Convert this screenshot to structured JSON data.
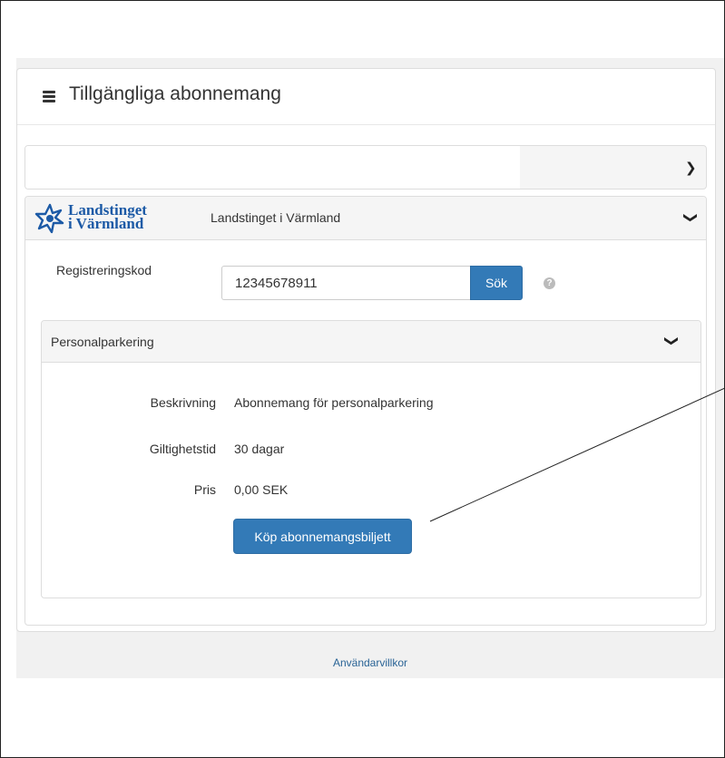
{
  "header": {
    "title": "Tillgängliga abonnemang",
    "icon": "list-icon"
  },
  "collapsed_panel": {
    "icon": "chevron-right-icon"
  },
  "organization": {
    "logo_line1": "Landstinget",
    "logo_line2": "i Värmland",
    "name": "Landstinget i Värmland",
    "icon": "chevron-down-icon"
  },
  "registration": {
    "label": "Registreringskod",
    "value": "12345678911",
    "search_label": "Sök",
    "help_glyph": "?"
  },
  "subscription": {
    "title": "Personalparkering",
    "rows": [
      {
        "label": "Beskrivning",
        "value": "Abonnemang för personalparkering"
      },
      {
        "label": "Giltighetstid",
        "value": "30 dagar"
      },
      {
        "label": "Pris",
        "value": "0,00 SEK"
      }
    ],
    "buy_label": "Köp abonnemangsbiljett"
  },
  "footer": {
    "terms_link": "Användarvillkor"
  },
  "colors": {
    "primary": "#337ab7",
    "logo": "#1c5aa6",
    "link": "#2a6496"
  }
}
